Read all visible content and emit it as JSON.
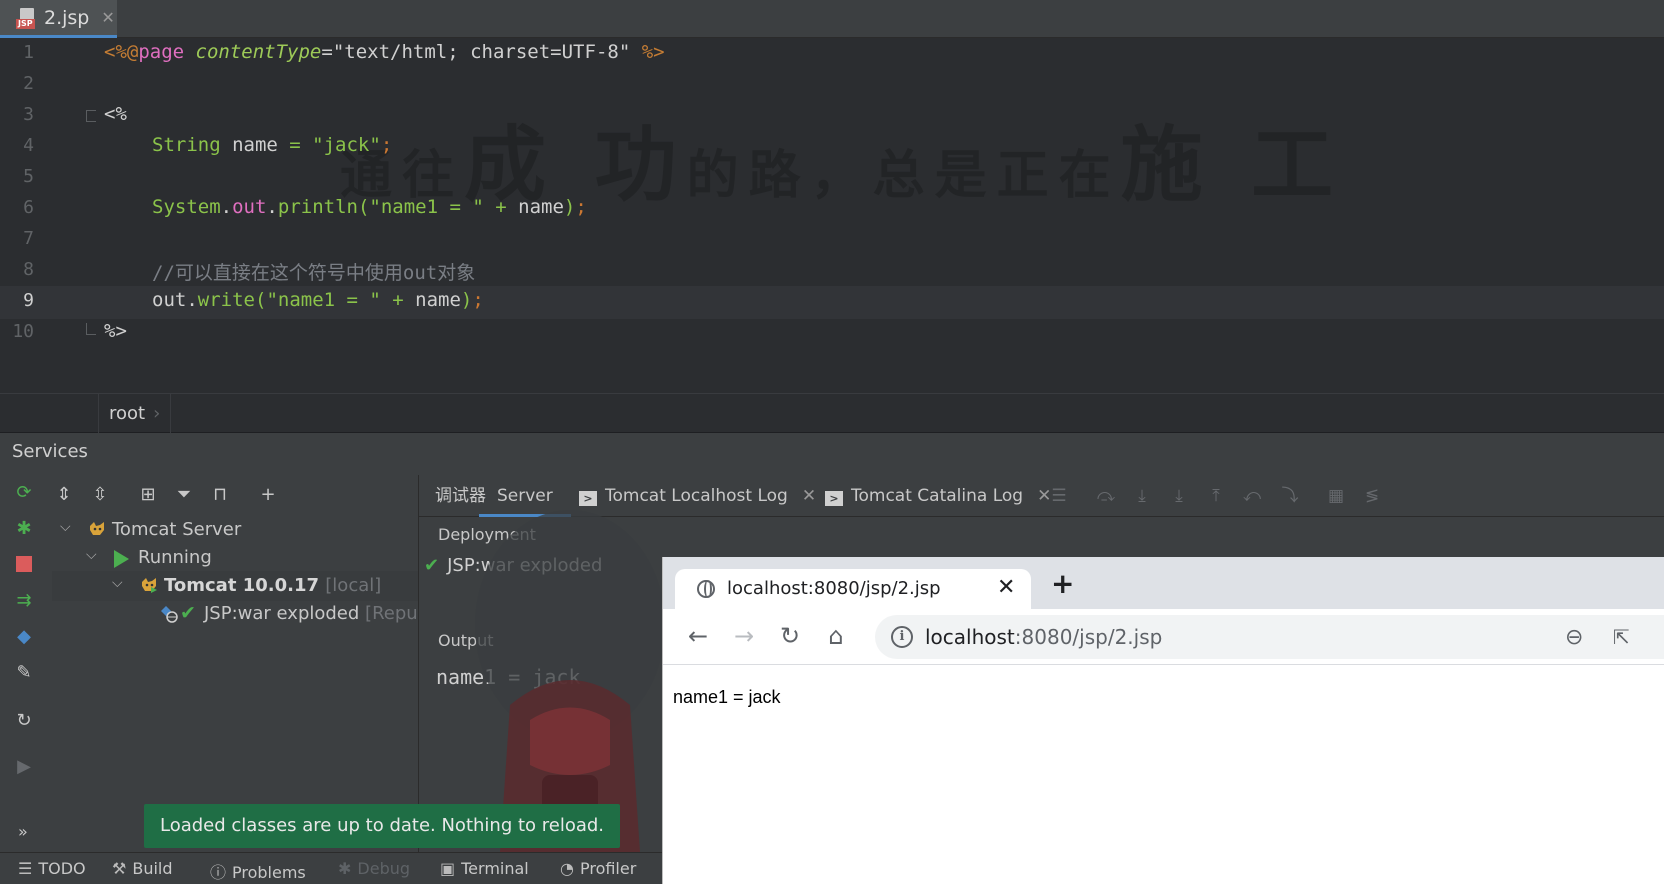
{
  "editor": {
    "tab_name": "2.jsp",
    "tab_icon_label": "JSP",
    "line_numbers": [
      "1",
      "2",
      "3",
      "4",
      "5",
      "6",
      "7",
      "8",
      "9",
      "10"
    ],
    "line1": {
      "open": "<%@",
      "directive": "page",
      "attr": "contentType",
      "eq": "=",
      "value": "\"text/html; charset=UTF-8\"",
      "close": "%>"
    },
    "line3": "<%",
    "line4": {
      "type": "String",
      "name": " name ",
      "eq": "= ",
      "value": "\"jack\"",
      "semi": ";"
    },
    "line6": {
      "cls": "System",
      "dot1": ".",
      "field": "out",
      "dot2": ".",
      "method": "println",
      "open": "(",
      "str": "\"name1 = \"",
      "plus": " + ",
      "var": "name",
      "close": ")",
      "semi": ";"
    },
    "line8": "//可以直接在这个符号中使用out对象",
    "line9": {
      "obj": "out",
      "dot": ".",
      "method": "write",
      "open": "(",
      "str": "\"name1 = \"",
      "plus": " + ",
      "var": "name",
      "close": ")",
      "semi": ";"
    },
    "line10": "%>",
    "breadcrumb": "root",
    "watermark": {
      "p1": "通往",
      "p2": "成 功",
      "p3": "的路，总是正在",
      "p4": "施 工"
    }
  },
  "services": {
    "title": "Services",
    "tree": {
      "server": "Tomcat Server",
      "running": "Running",
      "instance": "Tomcat 10.0.17",
      "instance_suffix": "[local]",
      "artifact": "JSP:war exploded",
      "artifact_suffix": "[Repu"
    },
    "tabs": {
      "debugger": "调试器",
      "server": "Server",
      "localhost_log": "Tomcat Localhost Log",
      "catalina_log": "Tomcat Catalina Log"
    },
    "deployment_label": "Deployment",
    "deployment_item": "JSP:war exploded",
    "output_label": "Output",
    "output_text": "name1 = jack",
    "toast": "Loaded classes are up to date. Nothing to reload."
  },
  "bottom_bar": {
    "todo": "TODO",
    "build": "Build",
    "problems": "Problems",
    "debug": "Debug",
    "terminal": "Terminal",
    "profiler": "Profiler",
    "more": "»"
  },
  "browser": {
    "tab_title": "localhost:8080/jsp/2.jsp",
    "url_host": "localhost",
    "url_rest": ":8080/jsp/2.jsp",
    "page_text": "name1 = jack"
  },
  "colors": {
    "ide_bg": "#2b2d30",
    "panel_bg": "#3c3f41",
    "accent": "#4a88c7",
    "success": "#4caf50",
    "toast_bg": "#1f6e45"
  }
}
